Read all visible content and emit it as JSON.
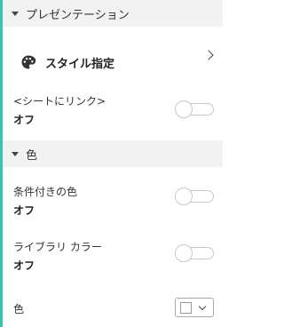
{
  "sections": {
    "presentation": {
      "title": "プレゼンテーション"
    },
    "color": {
      "title": "色"
    }
  },
  "style_row": {
    "label": "スタイル指定"
  },
  "fields": {
    "link_to_sheet": {
      "label": "<シートにリンク>",
      "value": "オフ"
    },
    "conditional_color": {
      "label": "条件付きの色",
      "value": "オフ"
    },
    "library_color": {
      "label": "ライブラリ カラー",
      "value": "オフ"
    },
    "color": {
      "label": "色"
    }
  },
  "colors": {
    "accent": "#33c6b0",
    "header_bg": "#f2f2f2"
  },
  "icons": {
    "palette": "palette-icon",
    "chevron_right": "chevron-right-icon",
    "caret_down": "caret-down-icon"
  }
}
